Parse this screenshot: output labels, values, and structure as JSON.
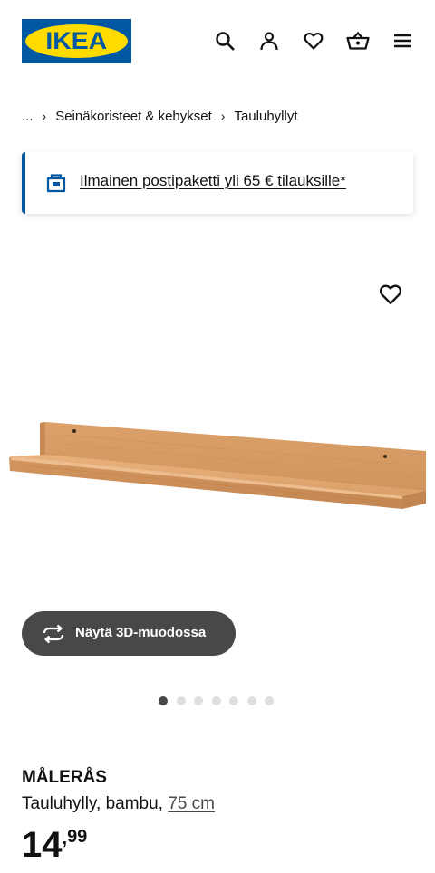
{
  "header": {
    "logo_text": "IKEA",
    "icons": [
      "search-icon",
      "user-icon",
      "heart-icon",
      "basket-icon",
      "menu-icon"
    ]
  },
  "breadcrumb": {
    "ellipsis": "...",
    "items": [
      "Seinäkoristeet & kehykset",
      "Tauluhyllyt"
    ]
  },
  "banner": {
    "icon": "delivery-box-icon",
    "text": "Ilmainen postipaketti yli 65 € tilauksille*",
    "accent": "#0058a3"
  },
  "gallery": {
    "favourite_icon": "heart-icon",
    "view_3d_label": "Näytä 3D-muodossa",
    "image_count": 7,
    "active_index": 0
  },
  "product": {
    "name": "MÅLERÅS",
    "description": "Tauluhylly, bambu, ",
    "size": "75 cm",
    "price_integer": "14",
    "price_separator": ",",
    "price_decimal": "99"
  },
  "colors": {
    "brand_blue": "#0058a3",
    "brand_yellow": "#ffdb00",
    "button_dark": "#484848"
  }
}
